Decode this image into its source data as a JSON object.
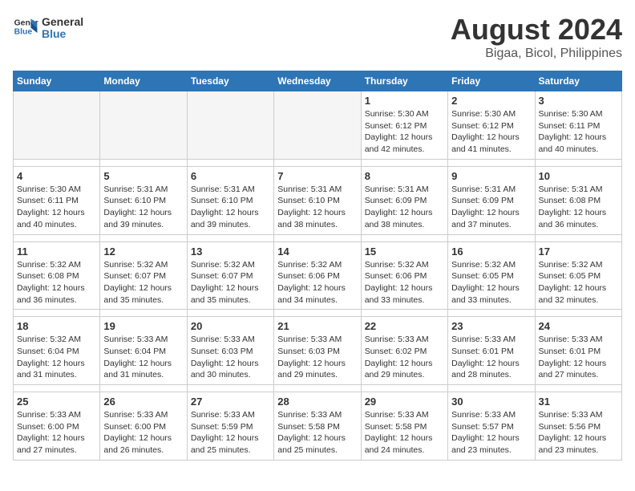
{
  "header": {
    "logo_line1": "General",
    "logo_line2": "Blue",
    "title": "August 2024",
    "subtitle": "Bigaa, Bicol, Philippines"
  },
  "calendar": {
    "days_of_week": [
      "Sunday",
      "Monday",
      "Tuesday",
      "Wednesday",
      "Thursday",
      "Friday",
      "Saturday"
    ],
    "weeks": [
      {
        "days": [
          {
            "date": "",
            "info": ""
          },
          {
            "date": "",
            "info": ""
          },
          {
            "date": "",
            "info": ""
          },
          {
            "date": "",
            "info": ""
          },
          {
            "date": "1",
            "info": "Sunrise: 5:30 AM\nSunset: 6:12 PM\nDaylight: 12 hours\nand 42 minutes."
          },
          {
            "date": "2",
            "info": "Sunrise: 5:30 AM\nSunset: 6:12 PM\nDaylight: 12 hours\nand 41 minutes."
          },
          {
            "date": "3",
            "info": "Sunrise: 5:30 AM\nSunset: 6:11 PM\nDaylight: 12 hours\nand 40 minutes."
          }
        ]
      },
      {
        "days": [
          {
            "date": "4",
            "info": "Sunrise: 5:30 AM\nSunset: 6:11 PM\nDaylight: 12 hours\nand 40 minutes."
          },
          {
            "date": "5",
            "info": "Sunrise: 5:31 AM\nSunset: 6:10 PM\nDaylight: 12 hours\nand 39 minutes."
          },
          {
            "date": "6",
            "info": "Sunrise: 5:31 AM\nSunset: 6:10 PM\nDaylight: 12 hours\nand 39 minutes."
          },
          {
            "date": "7",
            "info": "Sunrise: 5:31 AM\nSunset: 6:10 PM\nDaylight: 12 hours\nand 38 minutes."
          },
          {
            "date": "8",
            "info": "Sunrise: 5:31 AM\nSunset: 6:09 PM\nDaylight: 12 hours\nand 38 minutes."
          },
          {
            "date": "9",
            "info": "Sunrise: 5:31 AM\nSunset: 6:09 PM\nDaylight: 12 hours\nand 37 minutes."
          },
          {
            "date": "10",
            "info": "Sunrise: 5:31 AM\nSunset: 6:08 PM\nDaylight: 12 hours\nand 36 minutes."
          }
        ]
      },
      {
        "days": [
          {
            "date": "11",
            "info": "Sunrise: 5:32 AM\nSunset: 6:08 PM\nDaylight: 12 hours\nand 36 minutes."
          },
          {
            "date": "12",
            "info": "Sunrise: 5:32 AM\nSunset: 6:07 PM\nDaylight: 12 hours\nand 35 minutes."
          },
          {
            "date": "13",
            "info": "Sunrise: 5:32 AM\nSunset: 6:07 PM\nDaylight: 12 hours\nand 35 minutes."
          },
          {
            "date": "14",
            "info": "Sunrise: 5:32 AM\nSunset: 6:06 PM\nDaylight: 12 hours\nand 34 minutes."
          },
          {
            "date": "15",
            "info": "Sunrise: 5:32 AM\nSunset: 6:06 PM\nDaylight: 12 hours\nand 33 minutes."
          },
          {
            "date": "16",
            "info": "Sunrise: 5:32 AM\nSunset: 6:05 PM\nDaylight: 12 hours\nand 33 minutes."
          },
          {
            "date": "17",
            "info": "Sunrise: 5:32 AM\nSunset: 6:05 PM\nDaylight: 12 hours\nand 32 minutes."
          }
        ]
      },
      {
        "days": [
          {
            "date": "18",
            "info": "Sunrise: 5:32 AM\nSunset: 6:04 PM\nDaylight: 12 hours\nand 31 minutes."
          },
          {
            "date": "19",
            "info": "Sunrise: 5:33 AM\nSunset: 6:04 PM\nDaylight: 12 hours\nand 31 minutes."
          },
          {
            "date": "20",
            "info": "Sunrise: 5:33 AM\nSunset: 6:03 PM\nDaylight: 12 hours\nand 30 minutes."
          },
          {
            "date": "21",
            "info": "Sunrise: 5:33 AM\nSunset: 6:03 PM\nDaylight: 12 hours\nand 29 minutes."
          },
          {
            "date": "22",
            "info": "Sunrise: 5:33 AM\nSunset: 6:02 PM\nDaylight: 12 hours\nand 29 minutes."
          },
          {
            "date": "23",
            "info": "Sunrise: 5:33 AM\nSunset: 6:01 PM\nDaylight: 12 hours\nand 28 minutes."
          },
          {
            "date": "24",
            "info": "Sunrise: 5:33 AM\nSunset: 6:01 PM\nDaylight: 12 hours\nand 27 minutes."
          }
        ]
      },
      {
        "days": [
          {
            "date": "25",
            "info": "Sunrise: 5:33 AM\nSunset: 6:00 PM\nDaylight: 12 hours\nand 27 minutes."
          },
          {
            "date": "26",
            "info": "Sunrise: 5:33 AM\nSunset: 6:00 PM\nDaylight: 12 hours\nand 26 minutes."
          },
          {
            "date": "27",
            "info": "Sunrise: 5:33 AM\nSunset: 5:59 PM\nDaylight: 12 hours\nand 25 minutes."
          },
          {
            "date": "28",
            "info": "Sunrise: 5:33 AM\nSunset: 5:58 PM\nDaylight: 12 hours\nand 25 minutes."
          },
          {
            "date": "29",
            "info": "Sunrise: 5:33 AM\nSunset: 5:58 PM\nDaylight: 12 hours\nand 24 minutes."
          },
          {
            "date": "30",
            "info": "Sunrise: 5:33 AM\nSunset: 5:57 PM\nDaylight: 12 hours\nand 23 minutes."
          },
          {
            "date": "31",
            "info": "Sunrise: 5:33 AM\nSunset: 5:56 PM\nDaylight: 12 hours\nand 23 minutes."
          }
        ]
      }
    ]
  }
}
